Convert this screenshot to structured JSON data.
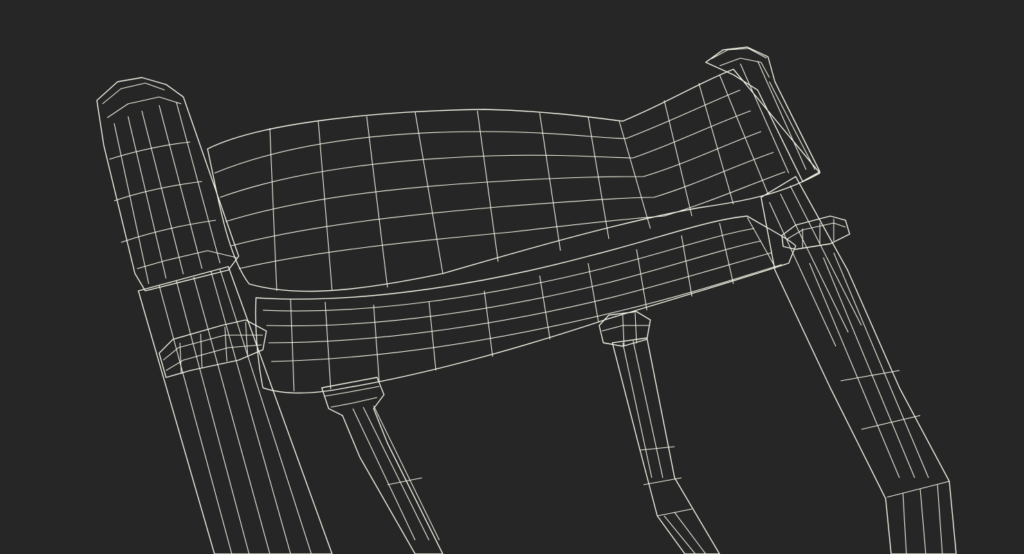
{
  "scene": {
    "subject": "chair",
    "render_style": "wireframe-over-shaded",
    "colors": {
      "background": "#262626",
      "surface_light": "#8d8d7d",
      "surface_mid": "#73746a",
      "surface_dark": "#5c5d55",
      "wire": "#f4f4e6"
    }
  }
}
